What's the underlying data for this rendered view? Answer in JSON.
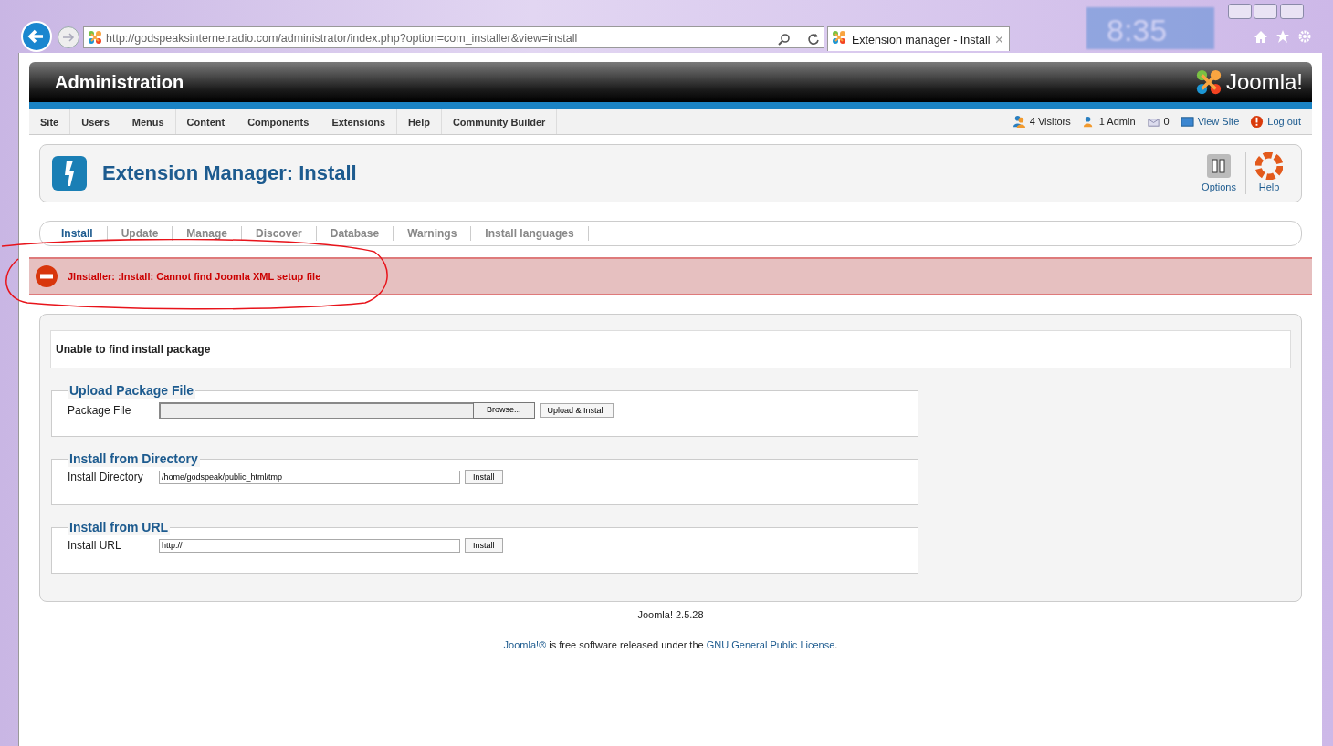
{
  "browser": {
    "address": "http://godspeaksinternetradio.com/administrator/index.php?option=com_installer&view=install",
    "tab_title": "Extension manager - Install",
    "tab_close": "×",
    "desktop_clock": "8:35"
  },
  "header": {
    "title": "Administration",
    "logo_text": "Joomla!"
  },
  "menu": [
    "Site",
    "Users",
    "Menus",
    "Content",
    "Components",
    "Extensions",
    "Help",
    "Community Builder"
  ],
  "status": [
    {
      "kind": "visitors",
      "text": "4 Visitors"
    },
    {
      "kind": "admins",
      "text": "1 Admin"
    },
    {
      "kind": "messages",
      "text": "0"
    },
    {
      "kind": "viewsite",
      "text": "View Site"
    },
    {
      "kind": "logout",
      "text": "Log out"
    }
  ],
  "toolbar": {
    "title": "Extension Manager: Install",
    "buttons": [
      {
        "kind": "options",
        "label": "Options"
      },
      {
        "kind": "help",
        "label": "Help"
      }
    ]
  },
  "tabs": [
    {
      "label": "Install",
      "selected": true
    },
    {
      "label": "Update",
      "selected": false
    },
    {
      "label": "Manage",
      "selected": false
    },
    {
      "label": "Discover",
      "selected": false
    },
    {
      "label": "Database",
      "selected": false
    },
    {
      "label": "Warnings",
      "selected": false
    },
    {
      "label": "Install languages",
      "selected": false
    }
  ],
  "error": "JInstaller: :Install: Cannot find Joomla XML setup file",
  "notice": "Unable to find install package",
  "sections": [
    {
      "kind": "file",
      "legend": "Upload Package File",
      "label": "Package File",
      "browse": "Browse...",
      "button": "Upload & Install"
    },
    {
      "kind": "text",
      "legend": "Install from Directory",
      "label": "Install Directory",
      "value": "/home/godspeak/public_html/tmp",
      "button": "Install"
    },
    {
      "kind": "text",
      "legend": "Install from URL",
      "label": "Install URL",
      "value": "http://",
      "button": "Install"
    }
  ],
  "footer": {
    "version": "Joomla! 2.5.28",
    "link_1": "Joomla!®",
    "text": " is free software released under the ",
    "link_2": "GNU General Public License",
    "end": "."
  }
}
